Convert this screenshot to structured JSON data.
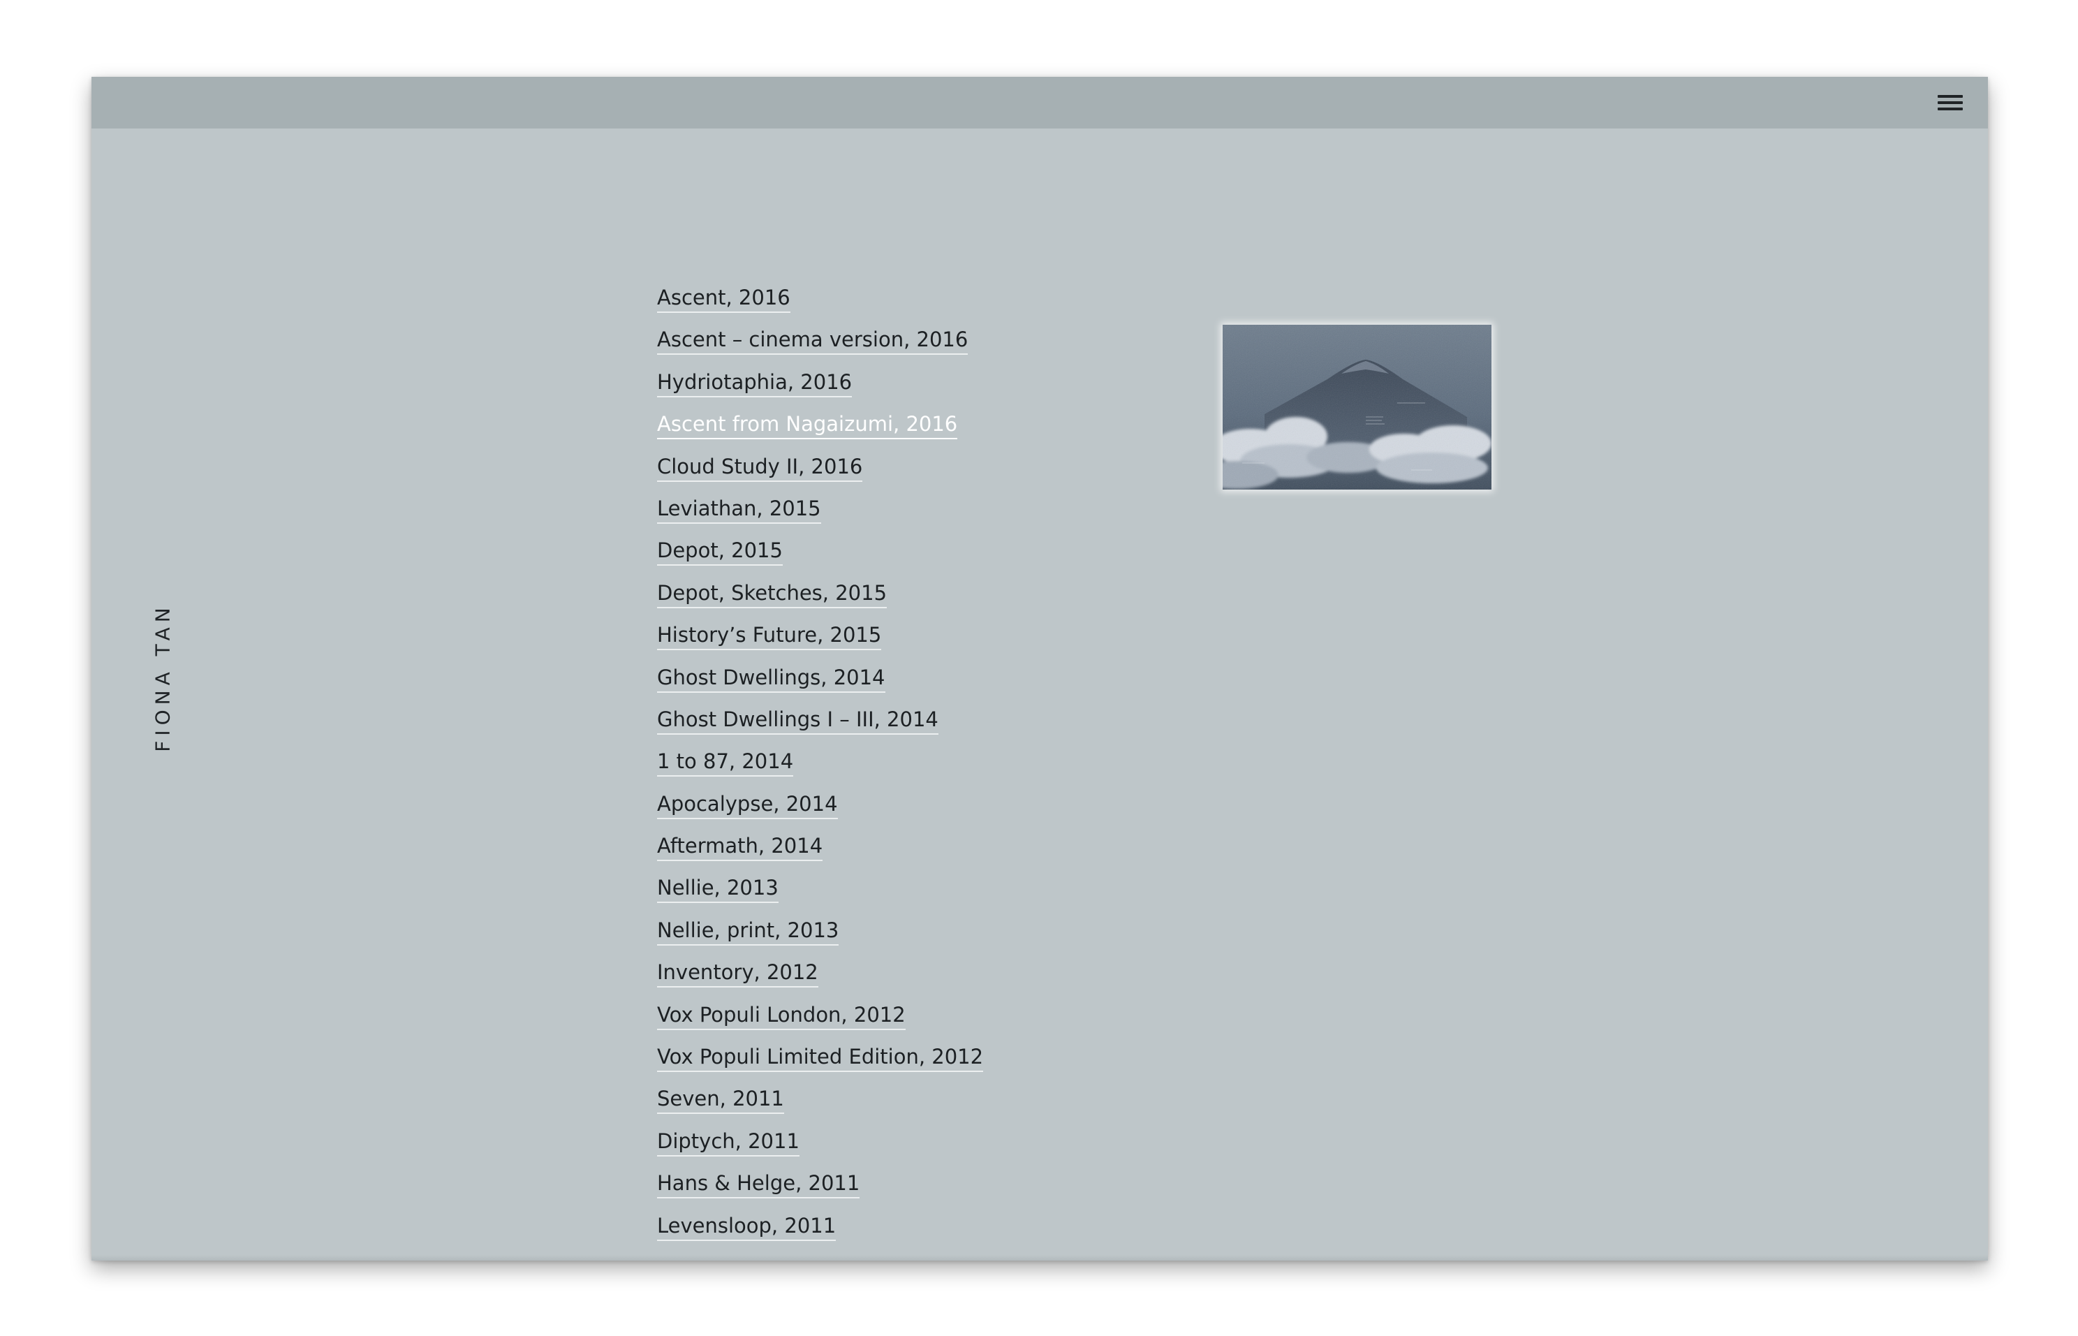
{
  "header": {
    "menu_icon": "hamburger-menu-icon"
  },
  "sidebar": {
    "artist_name": "FIONA TAN"
  },
  "colors": {
    "background": "#bec6c9",
    "topbar": "#a6b0b3",
    "link_text": "#1c2023",
    "active_link": "#ffffff"
  },
  "works": [
    {
      "label": "Ascent, 2016"
    },
    {
      "label": "Ascent – cinema version, 2016"
    },
    {
      "label": "Hydriotaphia, 2016"
    },
    {
      "label": "Ascent from Nagaizumi, 2016",
      "active": true
    },
    {
      "label": "Cloud Study II, 2016"
    },
    {
      "label": "Leviathan, 2015"
    },
    {
      "label": "Depot, 2015"
    },
    {
      "label": "Depot, Sketches, 2015"
    },
    {
      "label": "History’s Future, 2015"
    },
    {
      "label": "Ghost Dwellings, 2014"
    },
    {
      "label": "Ghost Dwellings I – III, 2014"
    },
    {
      "label": "1 to 87, 2014"
    },
    {
      "label": "Apocalypse, 2014"
    },
    {
      "label": "Aftermath, 2014"
    },
    {
      "label": "Nellie, 2013"
    },
    {
      "label": "Nellie, print, 2013"
    },
    {
      "label": "Inventory, 2012"
    },
    {
      "label": "Vox Populi London, 2012"
    },
    {
      "label": "Vox Populi Limited Edition, 2012"
    },
    {
      "label": "Seven, 2011"
    },
    {
      "label": "Diptych, 2011"
    },
    {
      "label": "Hans & Helge, 2011"
    },
    {
      "label": "Levensloop, 2011"
    }
  ],
  "preview": {
    "subject": "mountain-above-clouds-image"
  }
}
